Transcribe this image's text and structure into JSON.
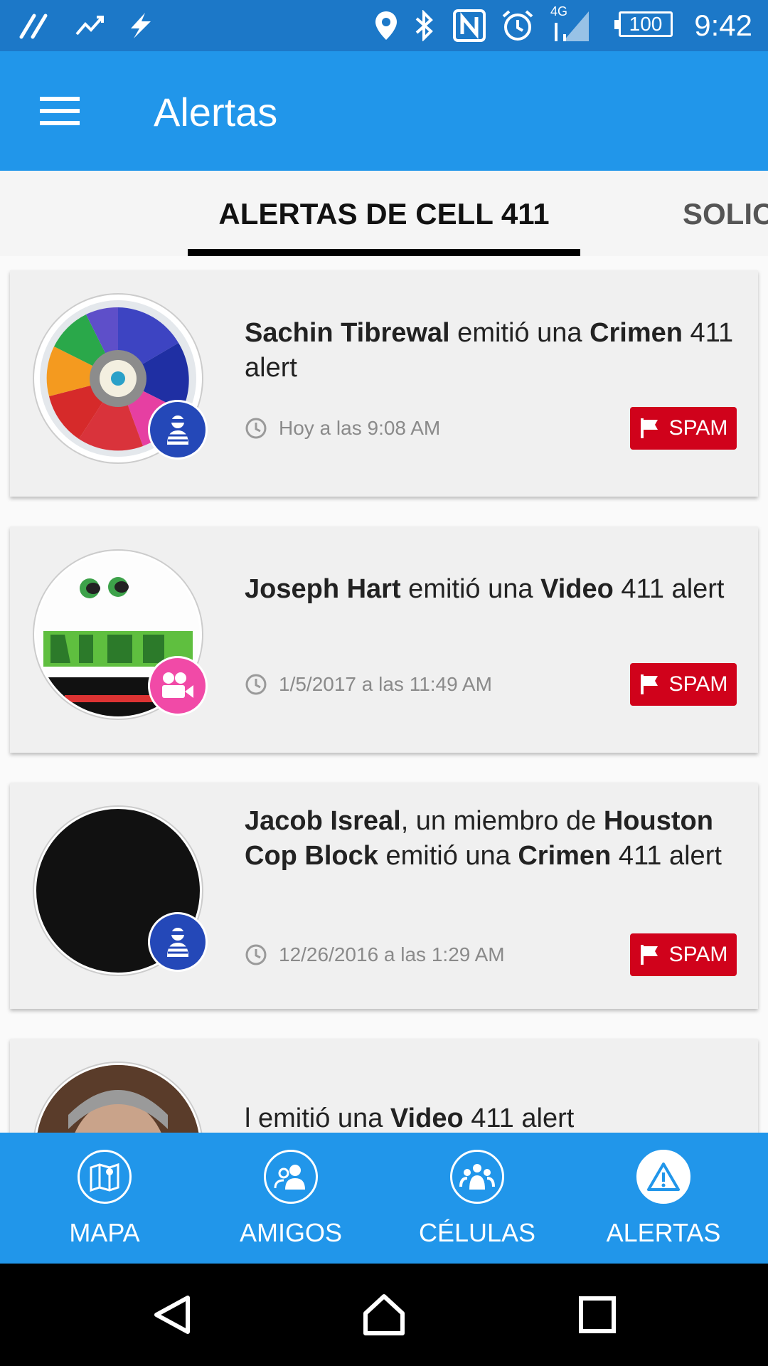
{
  "status_bar": {
    "time": "9:42",
    "battery": "100",
    "network": "4G",
    "icons": [
      "tool-icon",
      "trend-icon",
      "flash-icon",
      "location-icon",
      "bluetooth-icon",
      "nfc-icon",
      "alarm-icon",
      "signal-icon",
      "battery-icon"
    ]
  },
  "appbar": {
    "title": "Alertas",
    "menu_icon": "menu-icon"
  },
  "tabs": [
    {
      "label": "ALERTAS DE CELL 411",
      "active": true
    },
    {
      "label": "SOLIC",
      "active": false
    }
  ],
  "alerts": [
    {
      "name": "Sachin Tibrewal",
      "mid": " emitió una ",
      "type": "Crimen",
      "suffix": " 411 alert",
      "time": "Hoy a las 9:08 AM",
      "badge_icon": "crime-robber-icon",
      "spam_label": "SPAM"
    },
    {
      "name": "Joseph Hart",
      "mid": " emitió una ",
      "type": "Video",
      "suffix": " 411 alert",
      "time": "1/5/2017 a las 11:49 AM",
      "badge_icon": "video-camera-icon",
      "spam_label": "SPAM"
    },
    {
      "name": "Jacob Isreal",
      "member_text": ", un miembro de ",
      "group": "Houston Cop Block",
      "mid": " emitió una ",
      "type": "Crimen",
      "suffix": " 411 alert",
      "time": "12/26/2016 a las 1:29 AM",
      "badge_icon": "crime-robber-icon",
      "spam_label": "SPAM"
    },
    {
      "name": "",
      "mid": "l emitió una ",
      "type": "Video",
      "suffix": " 411 alert"
    }
  ],
  "bottom_nav": [
    {
      "label": "MAPA",
      "icon": "map-icon",
      "active": false
    },
    {
      "label": "AMIGOS",
      "icon": "friends-icon",
      "active": false
    },
    {
      "label": "CÉLULAS",
      "icon": "cells-icon",
      "active": false
    },
    {
      "label": "ALERTAS",
      "icon": "alert-icon",
      "active": true
    }
  ],
  "colors": {
    "primary": "#2196ea",
    "status_bar": "#1c78c8",
    "spam": "#d0021b",
    "crime_badge": "#2448b8",
    "video_badge": "#f14aa7"
  }
}
